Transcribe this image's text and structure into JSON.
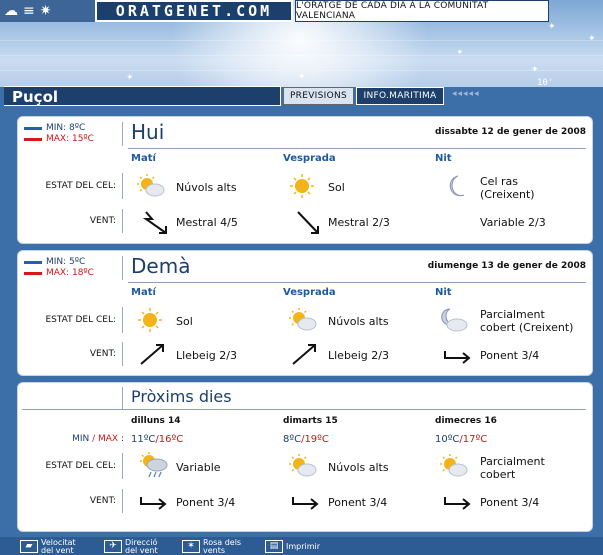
{
  "site": {
    "logo": "ORATGENET.COM",
    "tagline": "L'ORATGE DE CADA DIA A LA COMUNITAT VALENCIANA",
    "deco_number": "10'"
  },
  "city": "Puçol",
  "tabs": {
    "previsions": "PREVISIONS",
    "maritima": "INFO.MARITIMA",
    "arrows": "◂◂◂◂◂"
  },
  "labels": {
    "estat": "ESTAT DEL CEL:",
    "vent": "VENT:",
    "minmax_min": "MIN",
    "minmax_sep": " / ",
    "minmax_max": "MAX",
    "minmax_colon": " :"
  },
  "today": {
    "min": "MIN: 8ºC",
    "max": "MAX: 15ºC",
    "title": "Hui",
    "date": "dissabte 12 de gener de 2008",
    "periods": [
      "Matí",
      "Vesprada",
      "Nit"
    ],
    "sky": [
      "Núvols alts",
      "Sol",
      "Cel ras\n(Creixent)"
    ],
    "sky_icons": [
      "sun-cloud-icon",
      "sun-icon",
      "moon-icon"
    ],
    "wind": [
      "Mestral 4/5",
      "Mestral 2/3",
      "Variable 2/3"
    ],
    "wind_icons": [
      "wind-arrow-se-icon",
      "wind-arrow-se-icon",
      ""
    ]
  },
  "tomorrow": {
    "min": "MIN: 5ºC",
    "max": "MAX: 18ºC",
    "title": "Demà",
    "date": "diumenge 13 de gener de 2008",
    "periods": [
      "Matí",
      "Vesprada",
      "Nit"
    ],
    "sky": [
      "Sol",
      "Núvols alts",
      "Parcialment\ncobert (Creixent)"
    ],
    "sky_icons": [
      "sun-icon",
      "sun-cloud-icon",
      "moon-cloud-icon"
    ],
    "wind": [
      "Llebeig 2/3",
      "Llebeig 2/3",
      "Ponent 3/4"
    ],
    "wind_icons": [
      "wind-arrow-ne-icon",
      "wind-arrow-ne-icon",
      "wind-arrow-e-icon"
    ]
  },
  "next": {
    "title": "Pròxims dies",
    "days": [
      "dilluns 14",
      "dimarts 15",
      "dimecres 16"
    ],
    "min": [
      "11ºC",
      "8ºC",
      "10ºC"
    ],
    "sep": "/",
    "max": [
      "16ºC",
      "19ºC",
      "17ºC"
    ],
    "sky": [
      "Variable",
      "Núvols alts",
      "Parcialment\ncobert"
    ],
    "sky_icons": [
      "sun-rain-cloud-icon",
      "sun-cloud-icon",
      "sun-cloud-icon"
    ],
    "wind": [
      "Ponent 3/4",
      "Ponent 3/4",
      "Ponent 3/4"
    ],
    "wind_icons": [
      "wind-arrow-e-icon",
      "wind-arrow-e-icon",
      "wind-arrow-e-icon"
    ]
  },
  "footer": [
    {
      "label": "Velocitat\ndel vent",
      "icon": "truck-icon"
    },
    {
      "label": "Direcció\ndel vent",
      "icon": "plane-icon"
    },
    {
      "label": "Rosa dels\nvents",
      "icon": "compass-icon"
    },
    {
      "label": "Imprimir",
      "icon": "printer-icon"
    }
  ],
  "colors": {
    "navy": "#1d3f6b",
    "panel": "#3c6fa8",
    "max_red": "#c81818",
    "min_blue": "#2a5ea8",
    "header_blue": "#1d5aa0"
  }
}
